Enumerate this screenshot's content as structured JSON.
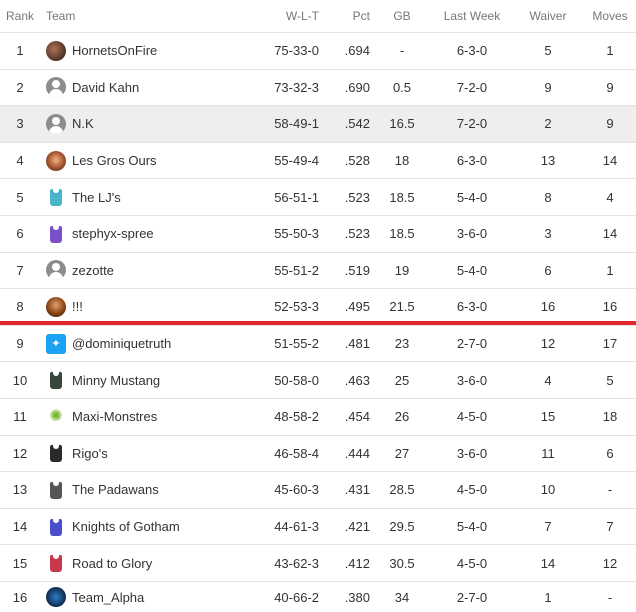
{
  "headers": {
    "rank": "Rank",
    "team": "Team",
    "wlt": "W-L-T",
    "pct": "Pct",
    "gb": "GB",
    "last_week": "Last Week",
    "waiver": "Waiver",
    "moves": "Moves"
  },
  "colors": {
    "divider": "#e0252b",
    "hover_row": "#eeeeee"
  },
  "rows": [
    {
      "rank": "1",
      "team": "HornetsOnFire",
      "icon": "team-photo-icon",
      "wlt": "75-33-0",
      "pct": ".694",
      "gb": "-",
      "last_week": "6-3-0",
      "waiver": "5",
      "moves": "1"
    },
    {
      "rank": "2",
      "team": "David Kahn",
      "icon": "default-avatar-icon",
      "wlt": "73-32-3",
      "pct": ".690",
      "gb": "0.5",
      "last_week": "7-2-0",
      "waiver": "9",
      "moves": "9"
    },
    {
      "rank": "3",
      "team": "N.K",
      "icon": "default-avatar-icon",
      "wlt": "58-49-1",
      "pct": ".542",
      "gb": "16.5",
      "last_week": "7-2-0",
      "waiver": "2",
      "moves": "9"
    },
    {
      "rank": "4",
      "team": "Les Gros Ours",
      "icon": "team-photo-icon",
      "wlt": "55-49-4",
      "pct": ".528",
      "gb": "18",
      "last_week": "6-3-0",
      "waiver": "13",
      "moves": "14"
    },
    {
      "rank": "5",
      "team": "The LJ's",
      "icon": "jersey-icon",
      "wlt": "56-51-1",
      "pct": ".523",
      "gb": "18.5",
      "last_week": "5-4-0",
      "waiver": "8",
      "moves": "4"
    },
    {
      "rank": "6",
      "team": "stephyx-spree",
      "icon": "jersey-icon",
      "wlt": "55-50-3",
      "pct": ".523",
      "gb": "18.5",
      "last_week": "3-6-0",
      "waiver": "3",
      "moves": "14"
    },
    {
      "rank": "7",
      "team": "zezotte",
      "icon": "default-avatar-icon",
      "wlt": "55-51-2",
      "pct": ".519",
      "gb": "19",
      "last_week": "5-4-0",
      "waiver": "6",
      "moves": "1"
    },
    {
      "rank": "8",
      "team": "!!!",
      "icon": "team-photo-icon",
      "wlt": "52-53-3",
      "pct": ".495",
      "gb": "21.5",
      "last_week": "6-3-0",
      "waiver": "16",
      "moves": "16"
    },
    {
      "rank": "9",
      "team": "@dominiquetruth",
      "icon": "twitter-icon",
      "wlt": "51-55-2",
      "pct": ".481",
      "gb": "23",
      "last_week": "2-7-0",
      "waiver": "12",
      "moves": "17"
    },
    {
      "rank": "10",
      "team": "Minny Mustang",
      "icon": "jersey-icon",
      "wlt": "50-58-0",
      "pct": ".463",
      "gb": "25",
      "last_week": "3-6-0",
      "waiver": "4",
      "moves": "5"
    },
    {
      "rank": "11",
      "team": "Maxi-Monstres",
      "icon": "monster-icon",
      "wlt": "48-58-2",
      "pct": ".454",
      "gb": "26",
      "last_week": "4-5-0",
      "waiver": "15",
      "moves": "18"
    },
    {
      "rank": "12",
      "team": "Rigo's",
      "icon": "jersey-icon",
      "wlt": "46-58-4",
      "pct": ".444",
      "gb": "27",
      "last_week": "3-6-0",
      "waiver": "11",
      "moves": "6"
    },
    {
      "rank": "13",
      "team": "The Padawans",
      "icon": "player-silhouette-icon",
      "wlt": "45-60-3",
      "pct": ".431",
      "gb": "28.5",
      "last_week": "4-5-0",
      "waiver": "10",
      "moves": "-"
    },
    {
      "rank": "14",
      "team": "Knights of Gotham",
      "icon": "jersey-icon",
      "wlt": "44-61-3",
      "pct": ".421",
      "gb": "29.5",
      "last_week": "5-4-0",
      "waiver": "7",
      "moves": "7"
    },
    {
      "rank": "15",
      "team": "Road to Glory",
      "icon": "jersey-icon",
      "wlt": "43-62-3",
      "pct": ".412",
      "gb": "30.5",
      "last_week": "4-5-0",
      "waiver": "14",
      "moves": "12"
    },
    {
      "rank": "16",
      "team": "Team_Alpha",
      "icon": "basketball-icon",
      "wlt": "40-66-2",
      "pct": ".380",
      "gb": "34",
      "last_week": "2-7-0",
      "waiver": "1",
      "moves": "-"
    }
  ]
}
